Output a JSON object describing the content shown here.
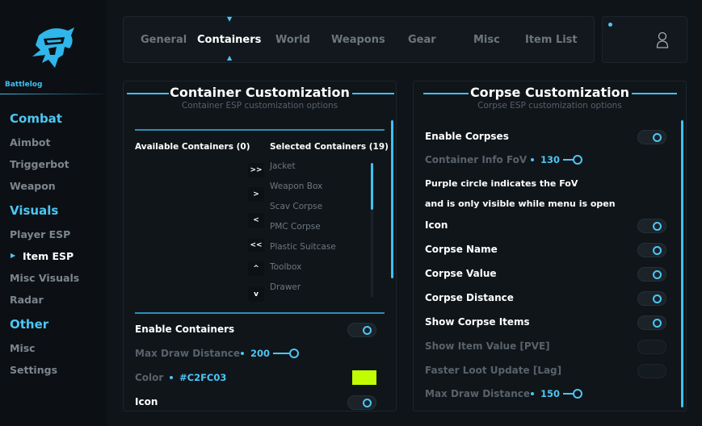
{
  "brand": {
    "name": "Battlelog",
    "accent": "#4cc6f4"
  },
  "sidebar": {
    "sections": [
      {
        "label": "Combat",
        "items": [
          "Aimbot",
          "Triggerbot",
          "Weapon"
        ]
      },
      {
        "label": "Visuals",
        "items": [
          "Player ESP",
          "Item ESP",
          "Misc Visuals",
          "Radar"
        ]
      },
      {
        "label": "Other",
        "items": [
          "Misc",
          "Settings"
        ]
      }
    ],
    "active_item": "Item ESP"
  },
  "tabs": [
    "General",
    "Containers",
    "World",
    "Weapons",
    "Gear",
    "Misc",
    "Item List"
  ],
  "active_tab": "Containers",
  "user": {
    "icon": "user-icon"
  },
  "container_panel": {
    "title": "Container Customization",
    "subtitle": "Container ESP customization options",
    "available_header": "Available Containers (0)",
    "selected_header": "Selected Containers (19)",
    "selected_items": [
      "Jacket",
      "Weapon Box",
      "Scav Corpse",
      "PMC Corpse",
      "Plastic Suitcase",
      "Toolbox",
      "Drawer"
    ],
    "move_buttons": [
      ">>",
      ">",
      "<",
      "<<",
      "^",
      "v"
    ],
    "enable_label": "Enable Containers",
    "enable_on": true,
    "max_draw_label": "Max Draw Distance",
    "max_draw_value": "200",
    "color_label": "Color",
    "color_value": "#C2FC03",
    "icon_label": "Icon",
    "icon_on": true
  },
  "corpse_panel": {
    "title": "Corpse Customization",
    "subtitle": "Corpse ESP customization options",
    "enable_label": "Enable Corpses",
    "fov_label": "Container Info FoV",
    "fov_value": "130",
    "note_line1": "Purple circle indicates the FoV",
    "note_line2": "and is only visible while menu is open",
    "toggles": [
      {
        "label": "Icon",
        "on": true
      },
      {
        "label": "Corpse Name",
        "on": true
      },
      {
        "label": "Corpse Value",
        "on": true
      },
      {
        "label": "Corpse Distance",
        "on": true
      },
      {
        "label": "Show Corpse Items",
        "on": true
      },
      {
        "label": "Show Item Value [PVE]",
        "on": false
      },
      {
        "label": "Faster Loot Update [Lag]",
        "on": false
      }
    ],
    "max_draw_label": "Max Draw Distance",
    "max_draw_value": "150"
  }
}
